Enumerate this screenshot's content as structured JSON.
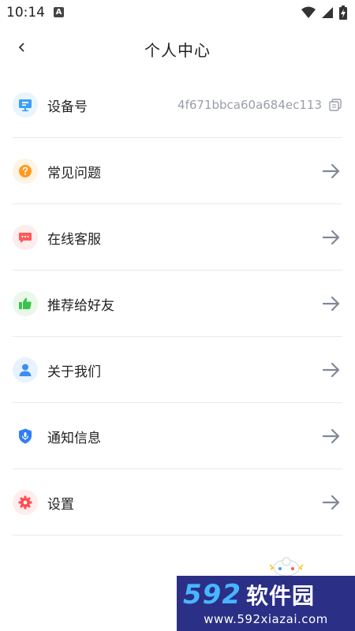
{
  "status_bar": {
    "time": "10:14",
    "notif_letter": "A"
  },
  "header": {
    "title": "个人中心"
  },
  "menu": [
    {
      "id": "device",
      "label": "设备号",
      "value": "4f671bbca60a684ec113",
      "icon": "monitor-icon"
    },
    {
      "id": "faq",
      "label": "常见问题",
      "icon": "question-icon"
    },
    {
      "id": "service",
      "label": "在线客服",
      "icon": "chat-icon"
    },
    {
      "id": "recommend",
      "label": "推荐给好友",
      "icon": "thumbs-up-icon"
    },
    {
      "id": "about",
      "label": "关于我们",
      "icon": "user-icon"
    },
    {
      "id": "notify",
      "label": "通知信息",
      "icon": "shield-icon"
    },
    {
      "id": "settings",
      "label": "设置",
      "icon": "gear-icon"
    }
  ],
  "watermark": {
    "num": "592",
    "name": "软件园",
    "url": "www.592xiazai.com"
  },
  "colors": {
    "monitor": "#3aa0f5",
    "faq": "#ff9a1f",
    "service": "#ff5a5a",
    "recommend": "#3ac34a",
    "about": "#3a8ef5",
    "notify": "#2f7df0",
    "settings": "#ff4d4f",
    "arrow": "#7f8898"
  }
}
